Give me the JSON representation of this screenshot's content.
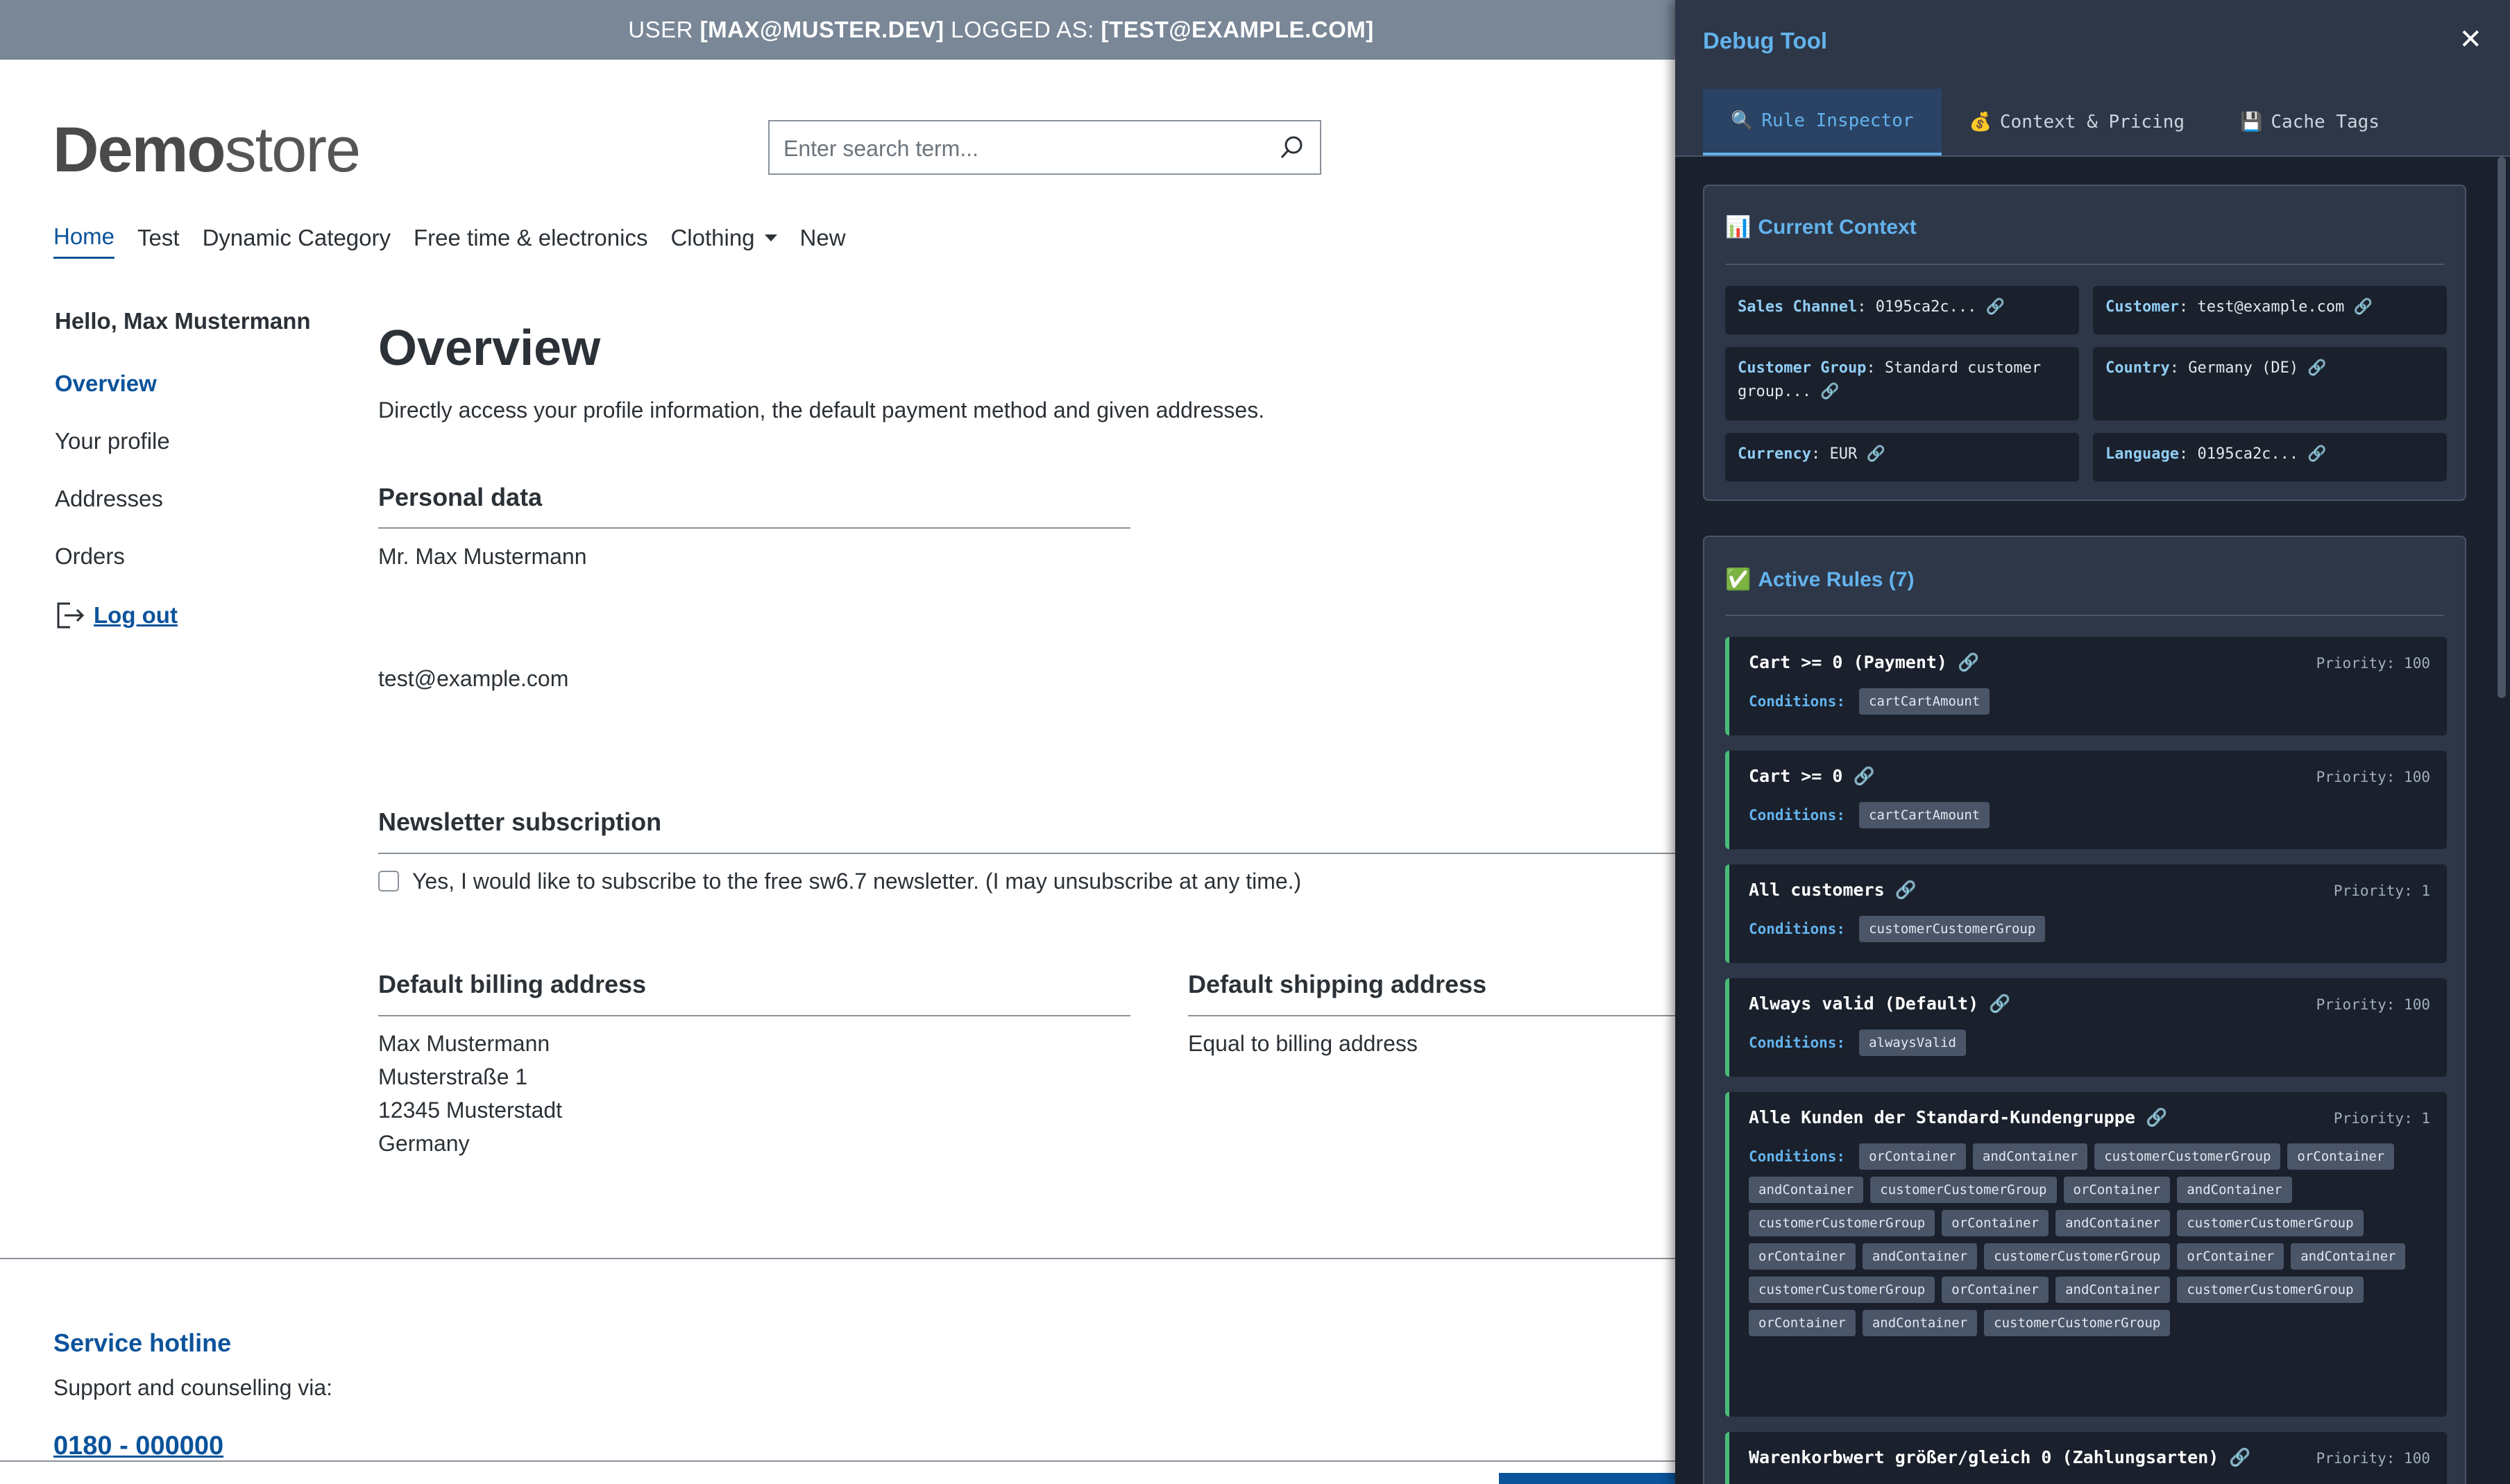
{
  "topbar": {
    "prefix": "USER ",
    "user": "[MAX@MUSTER.DEV]",
    "middle": " LOGGED AS: ",
    "logged_as": "[TEST@EXAMPLE.COM]"
  },
  "header": {
    "logo_bold": "Demo",
    "logo_light": "store",
    "search_placeholder": "Enter search term..."
  },
  "nav": [
    "Home",
    "Test",
    "Dynamic Category",
    "Free time & electronics",
    "Clothing",
    "New"
  ],
  "sidebar": {
    "greeting": "Hello, Max Mustermann",
    "items": [
      "Overview",
      "Your profile",
      "Addresses",
      "Orders"
    ],
    "logout": "Log out"
  },
  "main": {
    "title": "Overview",
    "description": "Directly access your profile information, the default payment method and given addresses.",
    "personal": {
      "title": "Personal data",
      "name": "Mr. Max Mustermann",
      "email": "test@example.com"
    },
    "newsletter": {
      "title": "Newsletter subscription",
      "label": "Yes, I would like to subscribe to the free sw6.7 newsletter. (I may unsubscribe at any time.)"
    },
    "billing": {
      "title": "Default billing address",
      "lines": [
        "Max Mustermann",
        "Musterstraße 1",
        "12345 Musterstadt",
        "Germany"
      ]
    },
    "shipping": {
      "title": "Default shipping address",
      "text": "Equal to billing address"
    }
  },
  "footer": {
    "hotline_title": "Service hotline",
    "hotline_sub": "Support and counselling via:",
    "hotline_number": "0180 - 000000"
  },
  "debug": {
    "title": "Debug Tool",
    "close": "✕",
    "tabs": [
      {
        "icon": "🔍",
        "label": "Rule Inspector"
      },
      {
        "icon": "💰",
        "label": "Context & Pricing"
      },
      {
        "icon": "💾",
        "label": "Cache Tags"
      }
    ],
    "context": {
      "icon": "📊",
      "title": "Current Context",
      "cells": [
        {
          "key": "Sales Channel",
          "value": "0195ca2c..."
        },
        {
          "key": "Customer",
          "value": "test@example.com"
        },
        {
          "key": "Customer Group",
          "value": "Standard customer group..."
        },
        {
          "key": "Country",
          "value": "Germany (DE)"
        },
        {
          "key": "Currency",
          "value": "EUR"
        },
        {
          "key": "Language",
          "value": "0195ca2c..."
        }
      ],
      "link_glyph": "🔗"
    },
    "rules": {
      "icon": "✅",
      "title": "Active Rules (7)",
      "conditions_label": "Conditions:",
      "items": [
        {
          "name": "Cart >= 0 (Payment)",
          "priority": "Priority: 100",
          "conditions": [
            "cartCartAmount"
          ]
        },
        {
          "name": "Cart >= 0",
          "priority": "Priority: 100",
          "conditions": [
            "cartCartAmount"
          ]
        },
        {
          "name": "All customers",
          "priority": "Priority: 1",
          "conditions": [
            "customerCustomerGroup"
          ]
        },
        {
          "name": "Always valid (Default)",
          "priority": "Priority: 100",
          "conditions": [
            "alwaysValid"
          ]
        },
        {
          "name": "Alle Kunden der Standard-Kundengruppe",
          "priority": "Priority: 1",
          "conditions": [
            "orContainer",
            "andContainer",
            "customerCustomerGroup",
            "orContainer",
            "andContainer",
            "customerCustomerGroup",
            "orContainer",
            "andContainer",
            "customerCustomerGroup",
            "orContainer",
            "andContainer",
            "customerCustomerGroup",
            "orContainer",
            "andContainer",
            "customerCustomerGroup",
            "orContainer",
            "andContainer",
            "customerCustomerGroup",
            "orContainer",
            "andContainer",
            "customerCustomerGroup",
            "orContainer",
            "andContainer",
            "customerCustomerGroup"
          ]
        },
        {
          "name": "Warenkorbwert größer/gleich 0 (Zahlungsarten)",
          "priority": "Priority: 100",
          "conditions": []
        }
      ]
    }
  }
}
